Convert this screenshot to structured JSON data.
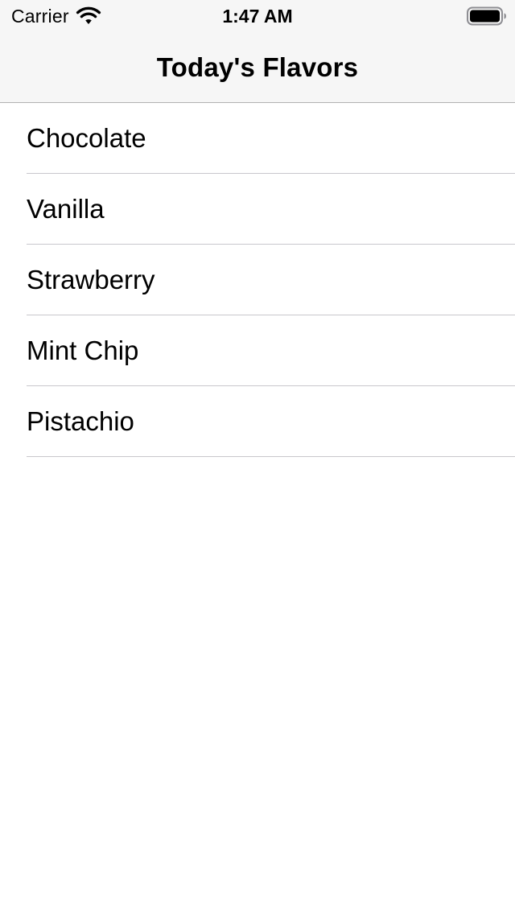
{
  "status_bar": {
    "carrier": "Carrier",
    "time": "1:47 AM",
    "wifi_icon": "wifi-icon",
    "battery_icon": "battery-full-icon"
  },
  "nav": {
    "title": "Today's Flavors"
  },
  "flavors": [
    {
      "label": "Chocolate"
    },
    {
      "label": "Vanilla"
    },
    {
      "label": "Strawberry"
    },
    {
      "label": "Mint Chip"
    },
    {
      "label": "Pistachio"
    }
  ],
  "colors": {
    "nav_background": "#f6f6f6",
    "separator": "#c8c7cc",
    "background": "#ffffff",
    "text": "#000000"
  }
}
